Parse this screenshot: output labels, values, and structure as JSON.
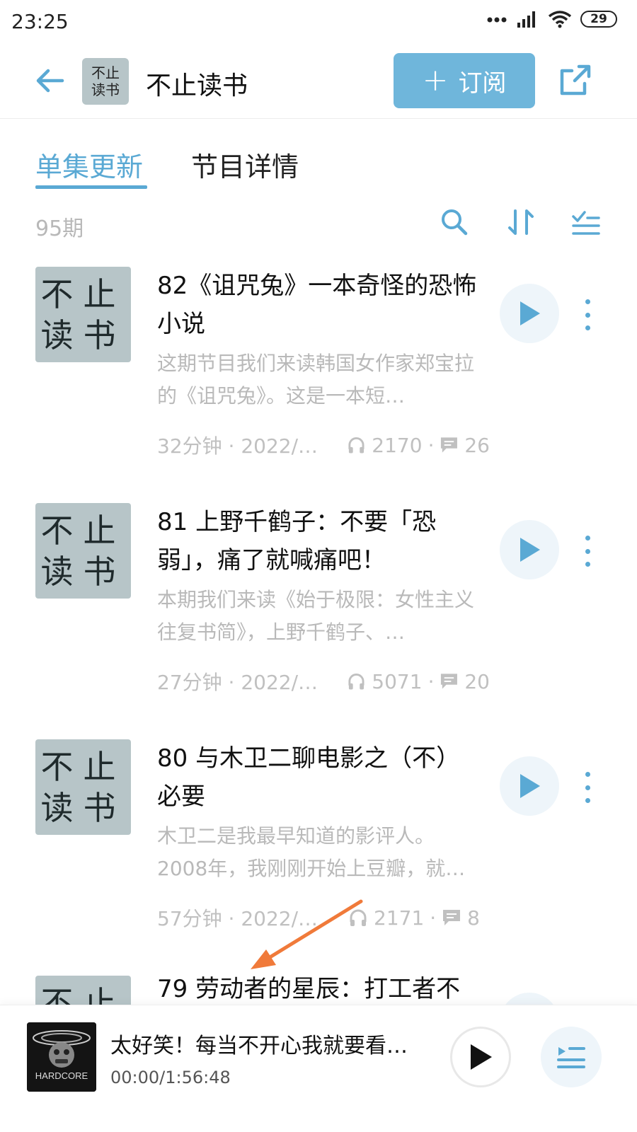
{
  "status_bar": {
    "time": "23:25",
    "battery": "29"
  },
  "header": {
    "title": "不止读书",
    "cover_line1": "不止",
    "cover_line2": "读书",
    "subscribe_label": "订阅"
  },
  "tabs": [
    {
      "label": "单集更新",
      "active": true
    },
    {
      "label": "节目详情",
      "active": false
    }
  ],
  "list_header": {
    "count": "95期"
  },
  "episodes": [
    {
      "title": "82《诅咒兔》一本奇怪的恐怖小说",
      "description": "这期节目我们来读韩国女作家郑宝拉的《诅咒兔》。这是一本短…",
      "duration_date": "32分钟 · 2022/1…",
      "plays": "2170",
      "comments": "26"
    },
    {
      "title": "81 上野千鹤子：不要「恐弱」，痛了就喊痛吧！",
      "description": "本期我们来读《始于极限：女性主义往复书简》，上野千鹤子、…",
      "duration_date": "27分钟 · 2022/1…",
      "plays": "5071",
      "comments": "20"
    },
    {
      "title": "80 与木卫二聊电影之（不）必要",
      "description": "木卫二是我最早知道的影评人。2008年，我刚刚开始上豆瓣，就…",
      "duration_date": "57分钟 · 2022/10/…",
      "plays": "2171",
      "comments": "8"
    },
    {
      "title": "79 劳动者的星辰：打工者不",
      "description": "",
      "duration_date": "",
      "plays": "",
      "comments": ""
    }
  ],
  "player": {
    "title": "太好笑！每当不开心我就要看…",
    "time": "00:00/1:56:48",
    "cover_text": "HARDCORE"
  },
  "colors": {
    "accent": "#5aa9d4",
    "subscribe_bg": "#6fb6db",
    "cover_bg": "#b7c5c8",
    "arrow": "#f07a3a"
  }
}
